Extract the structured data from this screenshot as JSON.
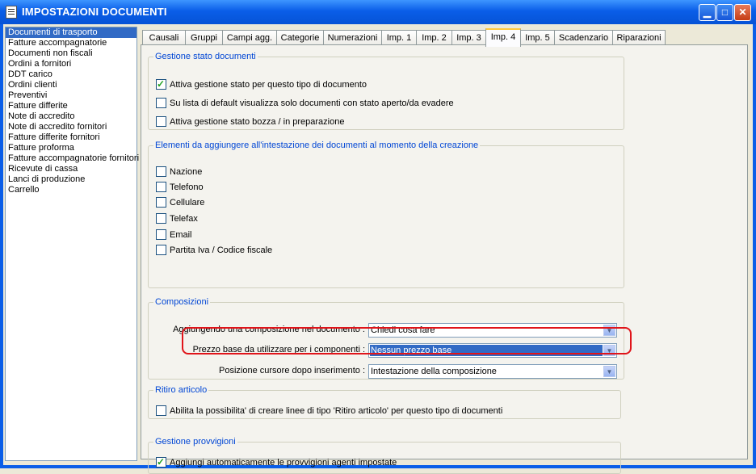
{
  "window": {
    "title": "IMPOSTAZIONI DOCUMENTI"
  },
  "doc_list": [
    "Documenti di trasporto",
    "Fatture accompagnatorie",
    "Documenti non fiscali",
    "Ordini a fornitori",
    "DDT carico",
    "Ordini clienti",
    "Preventivi",
    "Fatture differite",
    "Note di accredito",
    "Note di accredito fornitori",
    "Fatture differite fornitori",
    "Fatture proforma",
    "Fatture accompagnatorie fornitori",
    "Ricevute di cassa",
    "Lanci di produzione",
    "Carrello"
  ],
  "tabs": [
    "Causali",
    "Gruppi",
    "Campi agg.",
    "Categorie",
    "Numerazioni",
    "Imp. 1",
    "Imp. 2",
    "Imp. 3",
    "Imp. 4",
    "Imp. 5",
    "Scadenzario",
    "Riparazioni"
  ],
  "active_tab": "Imp. 4",
  "stato": {
    "legend": "Gestione stato documenti",
    "options": [
      {
        "label": "Attiva gestione stato per questo tipo di documento",
        "checked": true
      },
      {
        "label": "Su lista di default visualizza solo documenti con stato aperto/da evadere",
        "checked": false
      },
      {
        "label": "Attiva gestione stato bozza / in preparazione",
        "checked": false
      }
    ]
  },
  "elementi": {
    "legend": "Elementi da aggiungere all'intestazione dei documenti al momento della creazione",
    "options": [
      {
        "label": "Nazione",
        "checked": false
      },
      {
        "label": "Telefono",
        "checked": false
      },
      {
        "label": "Cellulare",
        "checked": false
      },
      {
        "label": "Telefax",
        "checked": false
      },
      {
        "label": "Email",
        "checked": false
      },
      {
        "label": "Partita Iva / Codice fiscale",
        "checked": false
      }
    ]
  },
  "composizioni": {
    "legend": "Composizioni",
    "rows": [
      {
        "label": "Aggiungendo una composizione nel documento :",
        "value": "Chiedi cosa fare"
      },
      {
        "label": "Prezzo base da utilizzare per i componenti :",
        "value": "Nessun prezzo base"
      },
      {
        "label": "Posizione cursore dopo inserimento :",
        "value": "Intestazione della composizione"
      }
    ]
  },
  "ritiro": {
    "legend": "Ritiro articolo",
    "option": {
      "label": "Abilita la possibilita' di creare linee di tipo 'Ritiro articolo' per questo tipo di documenti",
      "checked": false
    }
  },
  "provvigioni": {
    "legend": "Gestione provvigioni",
    "option": {
      "label": "Aggiungi automaticamente le provvigioni agenti impostate",
      "checked": true
    }
  },
  "colors": {
    "highlight": "#316ac5",
    "annotation": "#e0141a",
    "group_title": "#0046d5"
  }
}
